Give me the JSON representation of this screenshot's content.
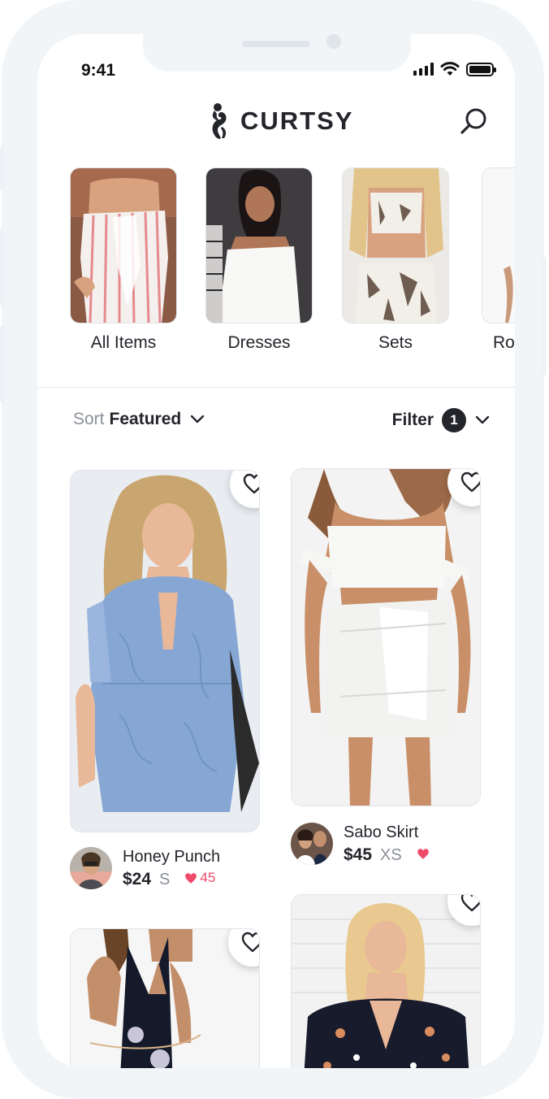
{
  "status": {
    "time": "9:41"
  },
  "header": {
    "brand": "CURTSY",
    "logo_icon": "curtsy-logo-icon",
    "search_icon": "search-icon"
  },
  "categories": [
    {
      "label": "All Items"
    },
    {
      "label": "Dresses"
    },
    {
      "label": "Sets"
    },
    {
      "label": "Ro"
    }
  ],
  "toolbar": {
    "sort_key": "Sort",
    "sort_value": "Featured",
    "filter_label": "Filter",
    "filter_count": "1"
  },
  "products": [
    {
      "name": "Honey Punch",
      "price": "$24",
      "size": "S",
      "likes": "45"
    },
    {
      "name": "Sabo Skirt",
      "price": "$45",
      "size": "XS",
      "likes": ""
    }
  ],
  "colors": {
    "accent_heart": "#ef4a68",
    "text_dark": "#23252b",
    "text_muted": "#8a8f98",
    "frame": "#f2f5f8"
  }
}
